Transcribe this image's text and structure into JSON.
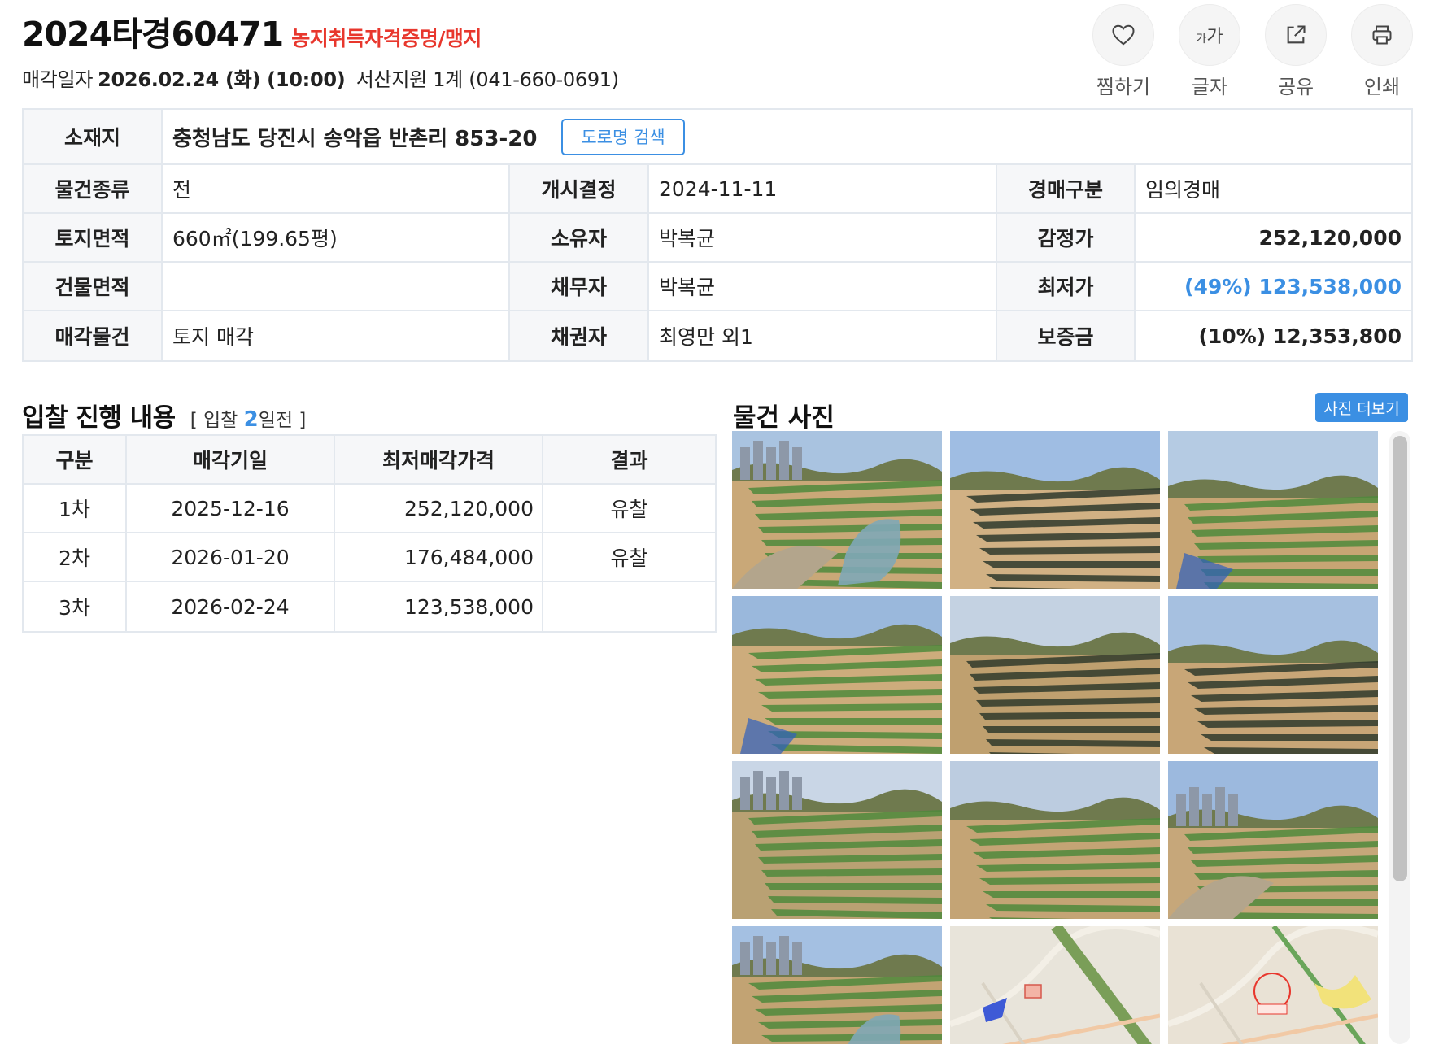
{
  "header": {
    "case_number": "2024타경60471",
    "case_tag": "농지취득자격증명/맹지",
    "sale_date_label": "매각일자",
    "sale_datetime": "2026.02.24 (화) (10:00)",
    "court": "서산지원 1계 (041-660-0691)"
  },
  "actions": [
    {
      "label": "찜하기",
      "icon": "heart-icon"
    },
    {
      "label": "글자",
      "icon": "font-size-icon",
      "glyph_small": "가",
      "glyph_large": "가"
    },
    {
      "label": "공유",
      "icon": "share-icon"
    },
    {
      "label": "인쇄",
      "icon": "printer-icon"
    }
  ],
  "info": {
    "address_label": "소재지",
    "address": "충청남도 당진시 송악읍 반촌리 853-20",
    "road_search_button": "도로명 검색",
    "rows": [
      {
        "l1": "물건종류",
        "v1": "전",
        "l2": "개시결정",
        "v2": "2024-11-11",
        "l3": "경매구분",
        "v3": "임의경매"
      },
      {
        "l1": "토지면적",
        "v1": "660㎡(199.65평)",
        "l2": "소유자",
        "v2": "박복균",
        "l3": "감정가",
        "v3": "252,120,000"
      },
      {
        "l1": "건물면적",
        "v1": "",
        "l2": "채무자",
        "v2": "박복균",
        "l3": "최저가",
        "v3": "(49%) 123,538,000"
      },
      {
        "l1": "매각물건",
        "v1": "토지 매각",
        "l2": "채권자",
        "v2": "최영만 외1",
        "l3": "보증금",
        "v3": "(10%) 12,353,800"
      }
    ]
  },
  "bid": {
    "title": "입찰 진행 내용",
    "sub_prefix": "[ 입찰 ",
    "sub_count": "2",
    "sub_suffix": "일전 ]",
    "columns": [
      "구분",
      "매각기일",
      "최저매각가격",
      "결과"
    ],
    "rows": [
      {
        "round": "1차",
        "date": "2025-12-16",
        "price": "252,120,000",
        "result": "유찰"
      },
      {
        "round": "2차",
        "date": "2026-01-20",
        "price": "176,484,000",
        "result": "유찰"
      },
      {
        "round": "3차",
        "date": "2026-02-24",
        "price": "123,538,000",
        "result": ""
      }
    ]
  },
  "photos": {
    "title": "물건 사진",
    "more_button": "사진 더보기",
    "colors": {
      "accent": "#3b8fe3",
      "alert": "#e8372d"
    },
    "items": [
      {
        "kind": "field",
        "variant": 0
      },
      {
        "kind": "field",
        "variant": 1
      },
      {
        "kind": "field",
        "variant": 2
      },
      {
        "kind": "field",
        "variant": 3
      },
      {
        "kind": "field",
        "variant": 4
      },
      {
        "kind": "field",
        "variant": 5
      },
      {
        "kind": "field",
        "variant": 6
      },
      {
        "kind": "field",
        "variant": 7
      },
      {
        "kind": "field",
        "variant": 8
      },
      {
        "kind": "field",
        "variant": 9
      },
      {
        "kind": "map",
        "variant": 0
      },
      {
        "kind": "map",
        "variant": 1
      }
    ]
  }
}
